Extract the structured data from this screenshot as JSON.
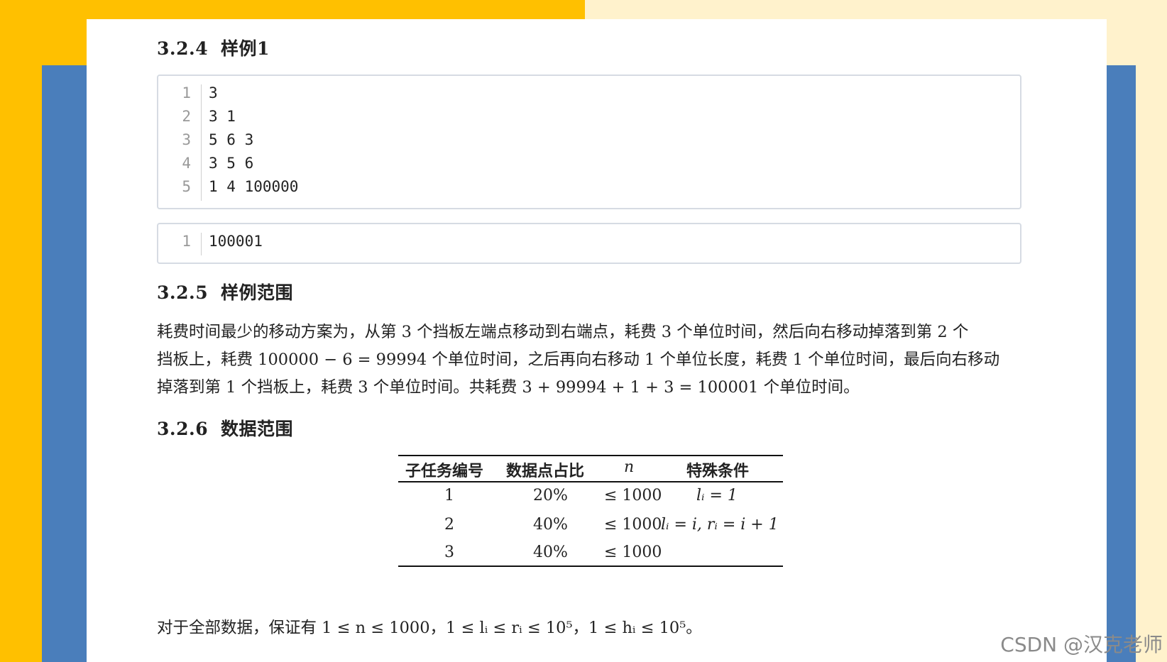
{
  "sections": {
    "s324": {
      "num": "3.2.4",
      "title": "样例1"
    },
    "s325": {
      "num": "3.2.5",
      "title": "样例范围"
    },
    "s326": {
      "num": "3.2.6",
      "title": "数据范围"
    }
  },
  "code_input": [
    {
      "ln": "1",
      "text": "3"
    },
    {
      "ln": "2",
      "text": "3 1"
    },
    {
      "ln": "3",
      "text": "5 6 3"
    },
    {
      "ln": "4",
      "text": "3 5 6"
    },
    {
      "ln": "5",
      "text": "1 4 100000"
    }
  ],
  "code_output": [
    {
      "ln": "1",
      "text": "100001"
    }
  ],
  "explanation": {
    "line1": "耗费时间最少的移动方案为，从第 3 个挡板左端点移动到右端点，耗费 3 个单位时间，然后向右移动掉落到第 2 个",
    "line2": "挡板上，耗费 100000 − 6 = 99994 个单位时间，之后再向右移动 1 个单位长度，耗费 1 个单位时间，最后向右移动",
    "line3": "掉落到第 1 个挡板上，耗费 3 个单位时间。共耗费 3 + 99994 + 1 + 3 = 100001 个单位时间。"
  },
  "table": {
    "headers": [
      "子任务编号",
      "数据点占比",
      "n",
      "特殊条件"
    ],
    "rows": [
      [
        "1",
        "20%",
        "≤ 1000",
        "lᵢ = 1"
      ],
      [
        "2",
        "40%",
        "≤ 1000",
        "lᵢ = i, rᵢ = i + 1"
      ],
      [
        "3",
        "40%",
        "≤ 1000",
        ""
      ]
    ]
  },
  "footer_text": "对于全部数据，保证有 1 ≤ n ≤ 1000，1 ≤ lᵢ ≤ rᵢ ≤ 10⁵，1 ≤ hᵢ ≤ 10⁵。",
  "watermark": "CSDN @汉克老师",
  "colors": {
    "yellow": "#ffc000",
    "cream": "#fff2cc",
    "blue": "#4a7ebb"
  }
}
